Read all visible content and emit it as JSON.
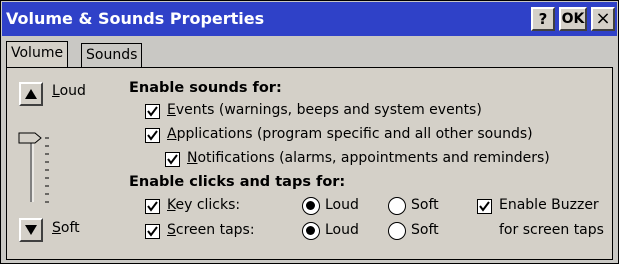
{
  "window": {
    "title": "Volume & Sounds Properties",
    "help_label": "?",
    "ok_label": "OK",
    "close_label": "×"
  },
  "tabs": [
    {
      "label": "Volume",
      "active": true
    },
    {
      "label": "Sounds",
      "active": false
    }
  ],
  "volume": {
    "loud_label": "Loud",
    "soft_label": "Soft",
    "up_icon": "triangle-up-icon",
    "down_icon": "triangle-down-icon",
    "level": 0.9
  },
  "sounds": {
    "heading": "Enable sounds for:",
    "events": {
      "label": "Events (warnings, beeps and system events)",
      "checked": true
    },
    "applications": {
      "label": "Applications (program specific and all other sounds)",
      "checked": true
    },
    "notifications": {
      "label": "Notifications (alarms, appointments and reminders)",
      "checked": true
    }
  },
  "clicks": {
    "heading": "Enable clicks and taps for:",
    "key_clicks": {
      "label": "Key clicks:",
      "checked": true,
      "loud_label": "Loud",
      "soft_label": "Soft",
      "selected": "Loud"
    },
    "screen_taps": {
      "label": "Screen taps:",
      "checked": true,
      "loud_label": "Loud",
      "soft_label": "Soft",
      "selected": "Loud"
    },
    "buzzer": {
      "label_line1": "Enable Buzzer",
      "label_line2": "for screen taps",
      "checked": true
    }
  }
}
